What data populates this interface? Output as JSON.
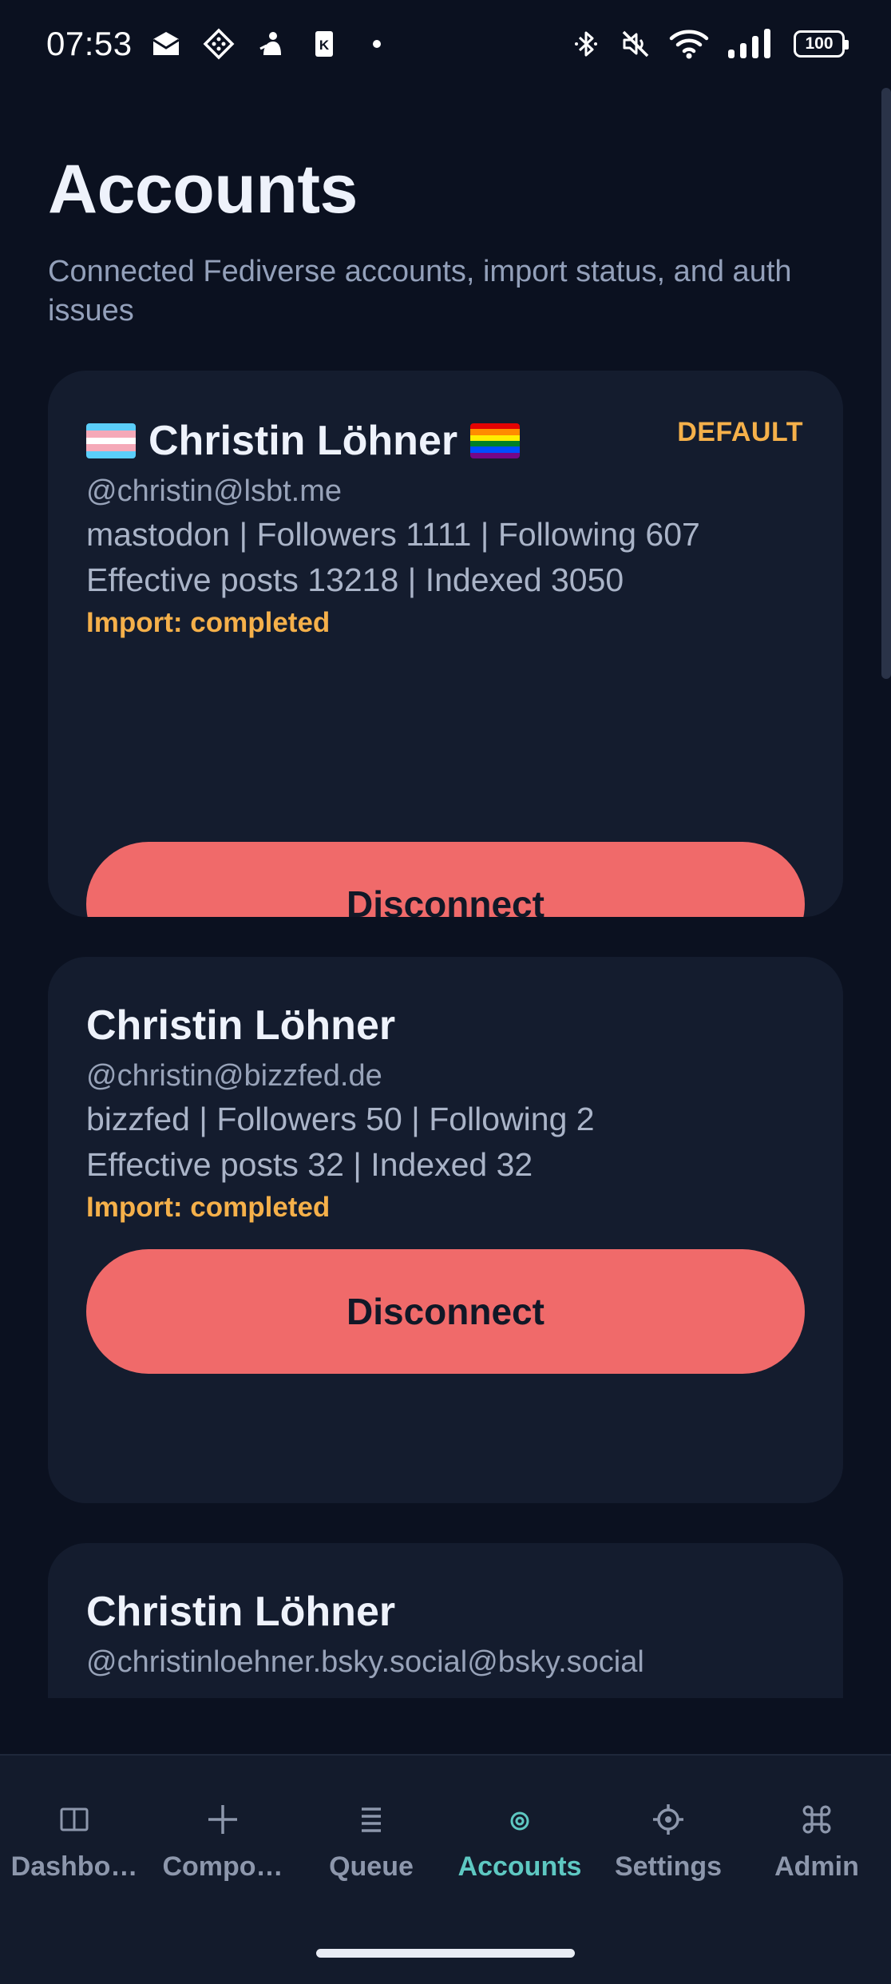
{
  "status_bar": {
    "time": "07:53",
    "battery": "100",
    "left_icons": [
      "mail-icon",
      "diamond-grid-icon",
      "person-icon",
      "k-app-icon",
      "dot-icon"
    ],
    "right_icons": [
      "bluetooth-icon",
      "mute-icon",
      "wifi-icon",
      "signal-icon",
      "battery-icon"
    ]
  },
  "page": {
    "title": "Accounts",
    "subtitle": "Connected Fediverse accounts, import status, and auth issues"
  },
  "accounts": [
    {
      "name": "Christin Löhner",
      "flags": [
        "trans-flag",
        "rainbow-flag"
      ],
      "badge": "DEFAULT",
      "handle": "@christin@lsbt.me",
      "stats": "mastodon | Followers 1111 | Following 607",
      "posts": "Effective posts 13218 | Indexed 3050",
      "import_status": "Import: completed",
      "button_label": "Disconnect"
    },
    {
      "name": "Christin Löhner",
      "handle": "@christin@bizzfed.de",
      "stats": "bizzfed | Followers 50 | Following 2",
      "posts": "Effective posts 32 | Indexed 32",
      "import_status": "Import: completed",
      "button_label": "Disconnect"
    },
    {
      "name": "Christin Löhner",
      "handle": "@christinloehner.bsky.social@bsky.social"
    }
  ],
  "nav": {
    "items": [
      {
        "label": "Dashbo…",
        "icon": "dashboard-icon"
      },
      {
        "label": "Compo…",
        "icon": "plus-icon"
      },
      {
        "label": "Queue",
        "icon": "list-icon"
      },
      {
        "label": "Accounts",
        "icon": "accounts-icon",
        "active": true
      },
      {
        "label": "Settings",
        "icon": "gear-icon"
      },
      {
        "label": "Admin",
        "icon": "command-icon"
      }
    ]
  },
  "colors": {
    "background": "#0b1120",
    "card": "#141c2e",
    "accent": "#5ec8c2",
    "warning": "#f5b04a",
    "danger": "#f06a6a"
  }
}
